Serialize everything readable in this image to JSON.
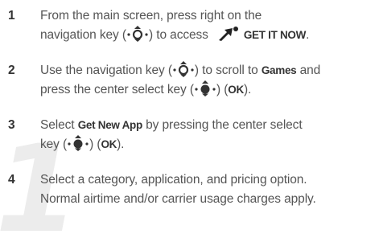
{
  "watermark": {
    "char": "1"
  },
  "steps": [
    {
      "num": "1",
      "l1": "From the main screen, press right on the",
      "l2a": "navigation key (",
      "l2b": ") to access",
      "brand": "GET IT NOW",
      "l2c": "."
    },
    {
      "num": "2",
      "l1a": "Use the navigation key (",
      "l1b": ") to scroll to",
      "kw1": "Games",
      "l1c": "and",
      "l2a": "press the center select key (",
      "l2b": ") (",
      "kw2": "OK",
      "l2c": ")."
    },
    {
      "num": "3",
      "l1a": "Select",
      "kw1": "Get New App",
      "l1b": "by pressing the center select",
      "l2a": "key (",
      "l2b": ") (",
      "kw2": "OK",
      "l2c": ")."
    },
    {
      "num": "4",
      "l1": "Select a category, application, and pricing option.",
      "l2": "Normal airtime and/or carrier usage charges apply."
    }
  ],
  "icons": {
    "nav": "navigation-key-icon",
    "center": "center-select-key-icon",
    "brand": "get-it-now-arrow-icon"
  }
}
